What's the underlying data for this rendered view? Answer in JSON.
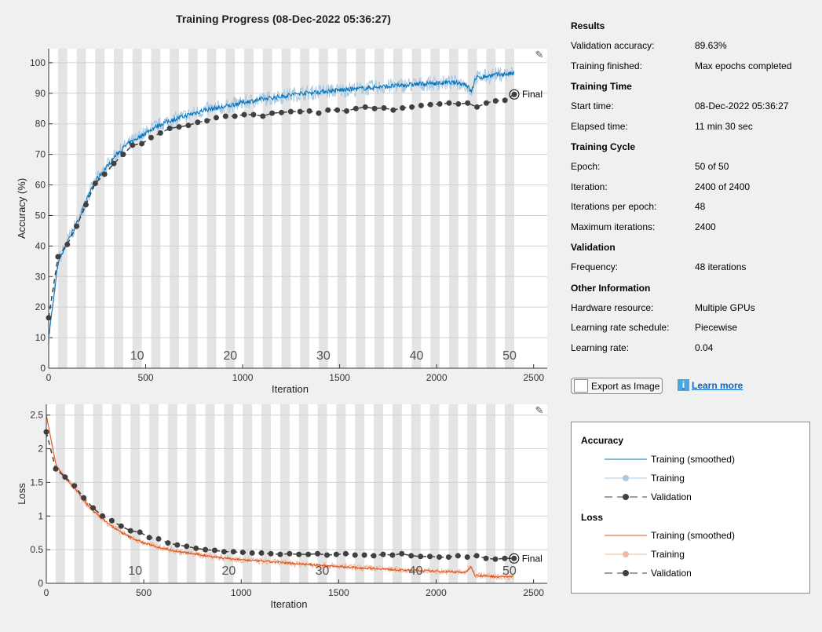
{
  "title": "Training Progress (08-Dec-2022 05:36:27)",
  "results": {
    "heading": "Results",
    "rows": [
      {
        "label": "Validation accuracy:",
        "value": "89.63%"
      },
      {
        "label": "Training finished:",
        "value": "Max epochs completed"
      }
    ]
  },
  "training_time": {
    "heading": "Training Time",
    "rows": [
      {
        "label": "Start time:",
        "value": "08-Dec-2022 05:36:27"
      },
      {
        "label": "Elapsed time:",
        "value": "11 min 30 sec"
      }
    ]
  },
  "training_cycle": {
    "heading": "Training Cycle",
    "rows": [
      {
        "label": "Epoch:",
        "value": "50 of 50"
      },
      {
        "label": "Iteration:",
        "value": "2400 of 2400"
      },
      {
        "label": "Iterations per epoch:",
        "value": "48"
      },
      {
        "label": "Maximum iterations:",
        "value": "2400"
      }
    ]
  },
  "validation": {
    "heading": "Validation",
    "rows": [
      {
        "label": "Frequency:",
        "value": "48 iterations"
      }
    ]
  },
  "other": {
    "heading": "Other Information",
    "rows": [
      {
        "label": "Hardware resource:",
        "value": "Multiple GPUs"
      },
      {
        "label": "Learning rate schedule:",
        "value": "Piecewise"
      },
      {
        "label": "Learning rate:",
        "value": "0.04"
      }
    ]
  },
  "buttons": {
    "export": "Export as Image",
    "learn_more": "Learn more"
  },
  "legend": {
    "accuracy": "Accuracy",
    "loss": "Loss",
    "smoothed": "Training (smoothed)",
    "training": "Training",
    "validation": "Validation"
  },
  "colors": {
    "acc_smoothed": "#0072bd",
    "acc_training": "#a9c9e3",
    "loss_smoothed": "#d95319",
    "loss_training": "#f0b9a0",
    "validation": "#404040",
    "epoch_band": "#e4e4e4"
  },
  "chart_data": [
    {
      "type": "line",
      "ylabel": "Accuracy (%)",
      "xlabel": "Iteration",
      "xlim": [
        0,
        2570
      ],
      "ylim": [
        0,
        104.6
      ],
      "xticks": [
        0,
        500,
        1000,
        1500,
        2000,
        2500
      ],
      "yticks": [
        0,
        10,
        20,
        30,
        40,
        50,
        60,
        70,
        80,
        90,
        100
      ],
      "epoch_labels": [
        10,
        20,
        30,
        40,
        50
      ],
      "grid": true,
      "final_label": "Final",
      "smoothed": {
        "x": [
          0,
          50,
          100,
          150,
          200,
          250,
          300,
          350,
          400,
          450,
          500,
          550,
          600,
          700,
          800,
          900,
          1000,
          1100,
          1200,
          1300,
          1400,
          1500,
          1600,
          1700,
          1800,
          1900,
          2000,
          2100,
          2150,
          2180,
          2200,
          2300,
          2400
        ],
        "y": [
          10,
          35,
          42,
          48,
          56,
          62,
          66,
          70,
          73,
          75,
          77,
          79,
          80.5,
          82.5,
          84.5,
          85.5,
          87,
          88,
          89,
          90,
          90.5,
          91,
          91.5,
          92,
          92.5,
          93,
          93.3,
          93.5,
          93,
          90.5,
          95,
          96,
          96.5
        ]
      },
      "validation": {
        "x_step": 48,
        "y": [
          16.5,
          36.5,
          40.5,
          46.5,
          53.5,
          60.5,
          63.5,
          67,
          70,
          73,
          73.5,
          75.5,
          77,
          78.5,
          79,
          79.5,
          80.5,
          81,
          82,
          82.5,
          82.5,
          83,
          83,
          82.5,
          83.5,
          83.7,
          84,
          84,
          84.2,
          83.5,
          84.5,
          84.5,
          84.2,
          85,
          85.5,
          85,
          85.2,
          84.5,
          85.2,
          85.5,
          86,
          86.3,
          86.5,
          86.8,
          86.5,
          86.8,
          85.5,
          86.8,
          87.5,
          87.7,
          89.63
        ]
      }
    },
    {
      "type": "line",
      "ylabel": "Loss",
      "xlabel": "Iteration",
      "xlim": [
        0,
        2570
      ],
      "ylim": [
        0,
        2.66
      ],
      "xticks": [
        0,
        500,
        1000,
        1500,
        2000,
        2500
      ],
      "yticks": [
        0,
        0.5,
        1,
        1.5,
        2,
        2.5
      ],
      "epoch_labels": [
        10,
        20,
        30,
        40,
        50
      ],
      "grid": true,
      "final_label": "Final",
      "smoothed": {
        "x": [
          0,
          50,
          100,
          150,
          200,
          250,
          300,
          350,
          400,
          450,
          500,
          600,
          700,
          800,
          900,
          1000,
          1100,
          1200,
          1300,
          1400,
          1500,
          1600,
          1700,
          1800,
          1900,
          2000,
          2100,
          2150,
          2180,
          2200,
          2300,
          2400
        ],
        "y": [
          2.5,
          1.75,
          1.55,
          1.4,
          1.2,
          1.05,
          0.93,
          0.82,
          0.73,
          0.66,
          0.6,
          0.52,
          0.46,
          0.42,
          0.38,
          0.35,
          0.33,
          0.31,
          0.29,
          0.27,
          0.25,
          0.23,
          0.22,
          0.2,
          0.19,
          0.18,
          0.17,
          0.16,
          0.25,
          0.12,
          0.1,
          0.1
        ]
      },
      "validation": {
        "x_step": 48,
        "y": [
          2.25,
          1.7,
          1.58,
          1.45,
          1.27,
          1.12,
          1.0,
          0.93,
          0.85,
          0.78,
          0.76,
          0.68,
          0.66,
          0.6,
          0.57,
          0.55,
          0.52,
          0.5,
          0.49,
          0.47,
          0.47,
          0.46,
          0.45,
          0.45,
          0.44,
          0.43,
          0.44,
          0.43,
          0.43,
          0.44,
          0.42,
          0.43,
          0.44,
          0.42,
          0.42,
          0.41,
          0.43,
          0.42,
          0.44,
          0.41,
          0.4,
          0.4,
          0.39,
          0.39,
          0.41,
          0.39,
          0.41,
          0.37,
          0.36,
          0.37,
          0.37
        ]
      }
    }
  ]
}
